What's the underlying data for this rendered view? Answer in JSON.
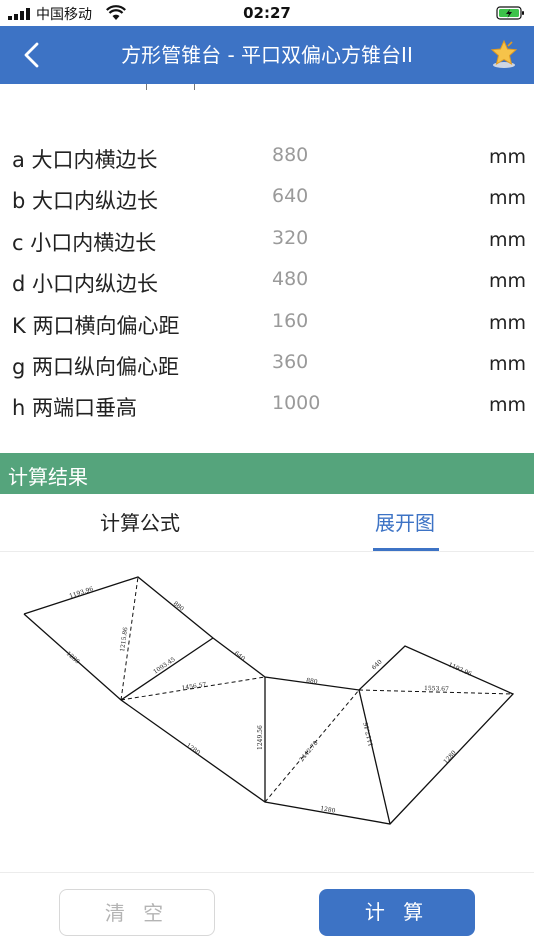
{
  "status_bar": {
    "carrier": "中国移动",
    "time": "02:27"
  },
  "nav": {
    "title": "方形管锥台 - 平口双偏心方锥台II",
    "back_icon": "chevron-left-icon",
    "favorite_icon": "star-icon"
  },
  "params": [
    {
      "label": "a 大口内横边长",
      "value": "880",
      "unit": "mm"
    },
    {
      "label": "b 大口内纵边长",
      "value": "640",
      "unit": "mm"
    },
    {
      "label": "c 小口内横边长",
      "value": "320",
      "unit": "mm"
    },
    {
      "label": "d 小口内纵边长",
      "value": "480",
      "unit": "mm"
    },
    {
      "label": "K 两口横向偏心距",
      "value": "160",
      "unit": "mm"
    },
    {
      "label": "g 两口纵向偏心距",
      "value": "360",
      "unit": "mm"
    },
    {
      "label": "h 两端口垂高",
      "value": "1000",
      "unit": "mm"
    }
  ],
  "result": {
    "title": "计算结果",
    "tabs": [
      {
        "label": "计算公式",
        "active": false
      },
      {
        "label": "展开图",
        "active": true
      }
    ]
  },
  "diagram_labels": {
    "l1": "1193.96",
    "l2": "880",
    "l3": "1280",
    "l4": "1215.86",
    "l5": "1093.45",
    "l6": "640",
    "l7": "1456.57",
    "l8": "880",
    "l9": "1280",
    "l10": "1249.56",
    "l11": "2442.78",
    "l12": "1117.46",
    "l13": "640",
    "l14": "1193.96",
    "l15": "1553.67",
    "l16": "1280",
    "l17": "1280"
  },
  "buttons": {
    "clear": "清 空",
    "calc": "计 算"
  },
  "colors": {
    "nav": "#3d73c5",
    "result_bar": "#55a47c",
    "accent": "#3d73c5"
  }
}
